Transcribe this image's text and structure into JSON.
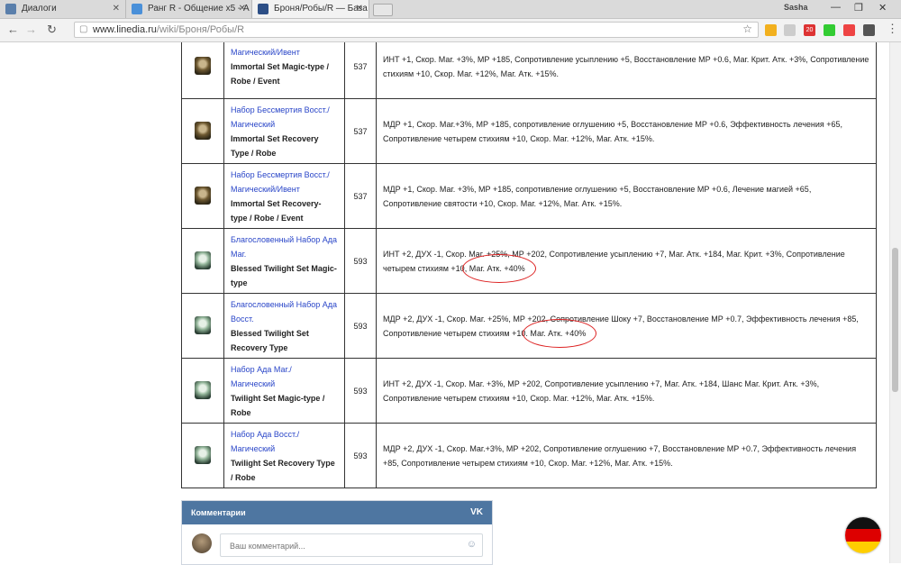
{
  "browser": {
    "tabs": [
      {
        "title": "Диалоги",
        "icon": "vk-icon"
      },
      {
        "title": "Ранг R - Общение х5 - А",
        "icon": "forum-icon"
      },
      {
        "title": "Броня/Робы/R — База з",
        "icon": "linedia-icon"
      }
    ],
    "user": "Sasha",
    "url_host": "www.linedia.ru",
    "url_path": "/wiki/Броня/Робы/R",
    "ext_badge": "20"
  },
  "table": {
    "rows": [
      {
        "ru": "Магический/Ивент",
        "en": "Immortal Set Magic-type / Robe / Event",
        "grade": "537",
        "stats": "ИНТ +1, Скор. Маг. +3%, МР +185, Сопротивление усыплению +5, Восстановление МР +0.6, Маг. Крит. Атк. +3%, Сопротивление стихиям +10, Скор. Маг. +12%, Маг. Атк. +15%.",
        "robe": "dark"
      },
      {
        "ru": "Набор Бессмертия Восст./ Магический",
        "en": "Immortal Set Recovery Type / Robe",
        "grade": "537",
        "stats": "МДР +1, Скор. Маг.+3%, МР +185, сопротивление оглушению +5, Восстановление МР +0.6, Эффективность лечения +65, Сопротивление четырем стихиям +10, Скор. Маг. +12%, Маг. Атк. +15%.",
        "robe": "dark"
      },
      {
        "ru": "Набор Бессмертия Восст./ Магический/Ивент",
        "en": "Immortal Set Recovery-type / Robe / Event",
        "grade": "537",
        "stats": "МДР +1, Скор. Маг. +3%, МР +185, сопротивление оглушению +5, Восстановление МР +0.6, Лечение магией +65, Сопротивление святости +10, Скор. Маг. +12%, Маг. Атк. +15%.",
        "robe": "dark"
      },
      {
        "ru": "Благословенный Набор Ада Маг.",
        "en": "Blessed Twilight Set Magic-type",
        "grade": "593",
        "stats_pre": "ИНТ +2, ДУХ -1, Скор. Маг. +25%, МР +202, Сопротивление усыплению +7, Маг. Атк. +184, Маг. Крит. +3%, Сопротивление четырем стихиям +10,",
        "stats_mark": "Маг. Атк. +40%",
        "robe": "green"
      },
      {
        "ru": "Благословенный Набор Ада Восст.",
        "en": "Blessed Twilight Set Recovery Type",
        "grade": "593",
        "stats_pre": "МДР +2, ДУХ -1, Скор. Маг. +25%, МР +202, Сопротивление Шоку +7, Восстановление МР +0.7, Эффективность лечения +85, Сопротивление четырем стихиям +10.",
        "stats_mark": "Маг. Атк. +40%",
        "robe": "green"
      },
      {
        "ru": "Набор Ада Маг./ Магический",
        "en": "Twilight Set Magic-type / Robe",
        "grade": "593",
        "stats": "ИНТ +2, ДУХ -1, Скор. Маг. +3%, МР +202, Сопротивление усыплению +7, Маг. Атк. +184, Шанс Маг. Крит. Атк. +3%, Сопротивление четырем стихиям +10, Скор. Маг. +12%, Маг. Атк. +15%.",
        "robe": "green"
      },
      {
        "ru": "Набор Ада Восст./ Магический",
        "en": "Twilight Set Recovery Type / Robe",
        "grade": "593",
        "stats": "МДР +2, ДУХ -1, Скор. Маг.+3%, МР +202, Сопротивление оглушению +7, Восстановление МР +0.7, Эффективность лечения +85, Сопротивление четырем стихиям +10, Скор. Маг. +12%, Маг. Атк. +15%.",
        "robe": "green"
      }
    ]
  },
  "comments": {
    "title": "Комментарии",
    "brand": "VK",
    "placeholder": "Ваш комментарий..."
  },
  "colors": {
    "link": "#2a46c8",
    "vk_header": "#4e76a1",
    "annotation": "#dd2222"
  }
}
